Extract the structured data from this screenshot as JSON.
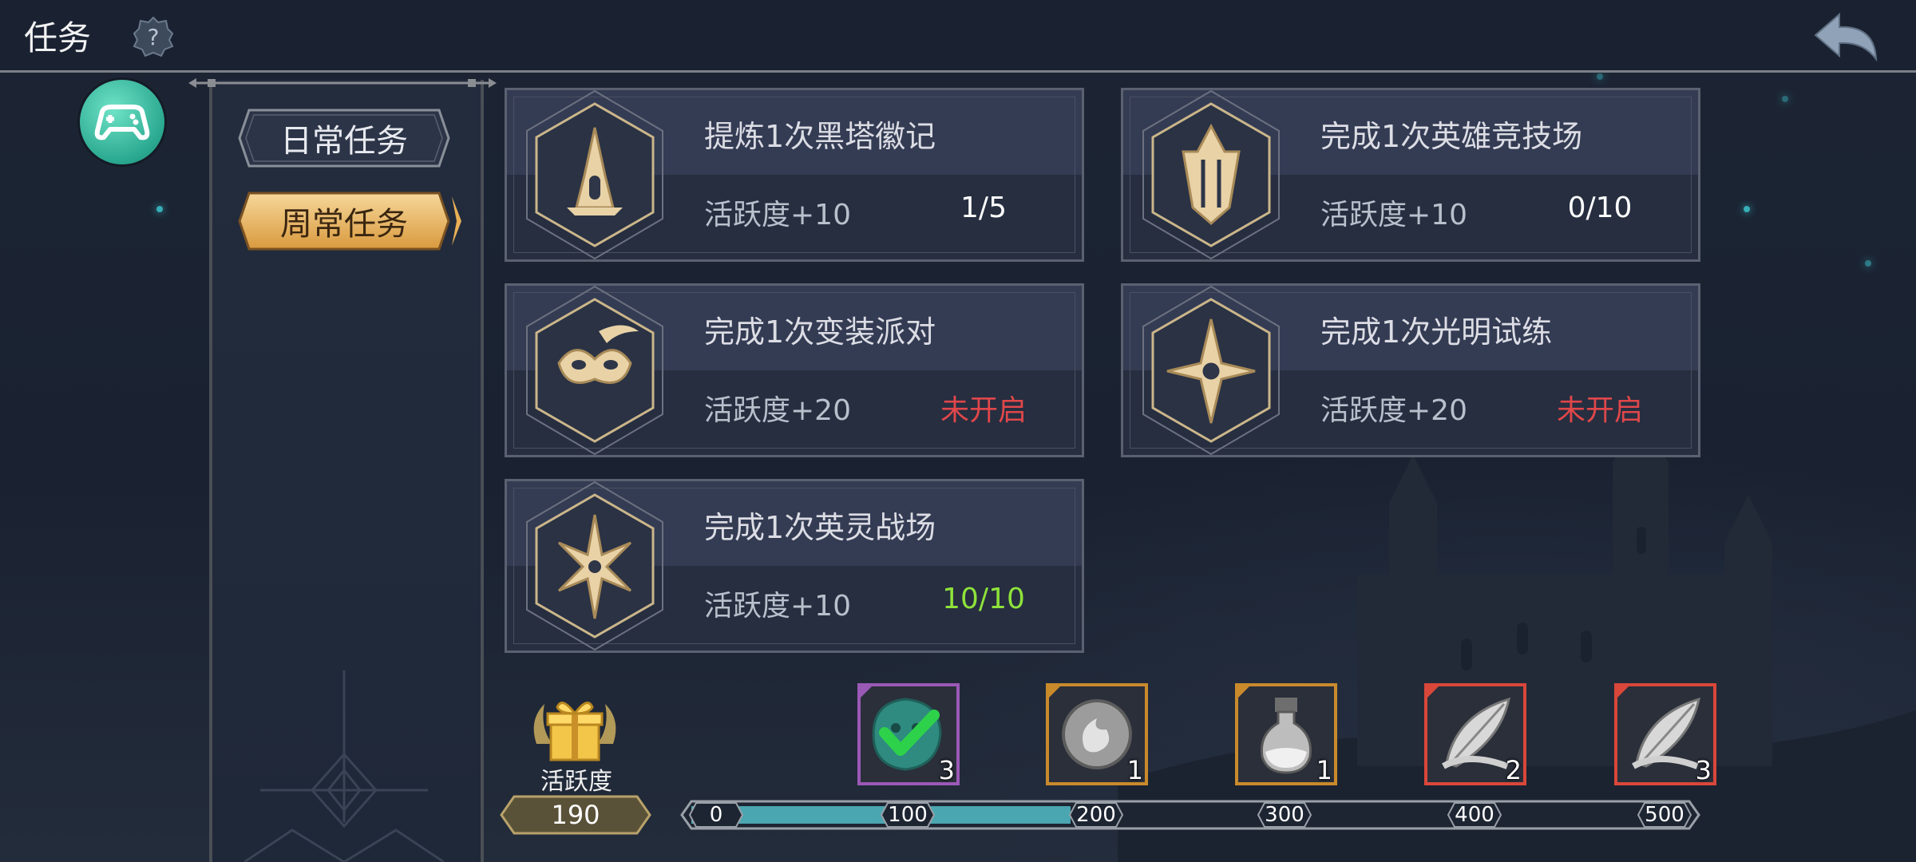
{
  "header": {
    "title": "任务"
  },
  "tabs": [
    {
      "label": "日常任务",
      "active": false
    },
    {
      "label": "周常任务",
      "active": true
    }
  ],
  "tasks": [
    {
      "name": "提炼1次黑塔徽记",
      "reward": "活跃度+10",
      "progress": "1/5",
      "status": "in-progress",
      "emblem": "black-tower-emblem-icon"
    },
    {
      "name": "完成1次英雄竞技场",
      "reward": "活跃度+10",
      "progress": "0/10",
      "status": "in-progress",
      "emblem": "hero-arena-emblem-icon"
    },
    {
      "name": "完成1次变装派对",
      "reward": "活跃度+20",
      "progress": "未开启",
      "status": "locked",
      "emblem": "masquerade-mask-emblem-icon"
    },
    {
      "name": "完成1次光明试练",
      "reward": "活跃度+20",
      "progress": "未开启",
      "status": "locked",
      "emblem": "light-trial-emblem-icon"
    },
    {
      "name": "完成1次英灵战场",
      "reward": "活跃度+10",
      "progress": "10/10",
      "status": "done",
      "emblem": "spirit-battlefield-emblem-icon"
    }
  ],
  "activity": {
    "label": "活跃度",
    "value": "190",
    "progress_value": 190,
    "max": 500
  },
  "milestones": [
    "0",
    "100",
    "200",
    "300",
    "400",
    "500"
  ],
  "rewards": [
    {
      "count": "3",
      "icon": "green-gem-icon",
      "claimed": true,
      "frame": "#9b59b6"
    },
    {
      "count": "1",
      "icon": "silver-coin-icon",
      "claimed": false,
      "frame": "#c98a2c"
    },
    {
      "count": "1",
      "icon": "potion-bottle-icon",
      "claimed": false,
      "frame": "#c98a2c"
    },
    {
      "count": "2",
      "icon": "silver-feather-icon",
      "claimed": false,
      "frame": "#d9473a"
    },
    {
      "count": "3",
      "icon": "silver-feather-icon",
      "claimed": false,
      "frame": "#d9473a"
    }
  ],
  "colors": {
    "locked_text": "#e0474a",
    "done_text": "#8ee23a",
    "progress_fill": "#4aa6b0",
    "gold": "#e8c27a"
  }
}
